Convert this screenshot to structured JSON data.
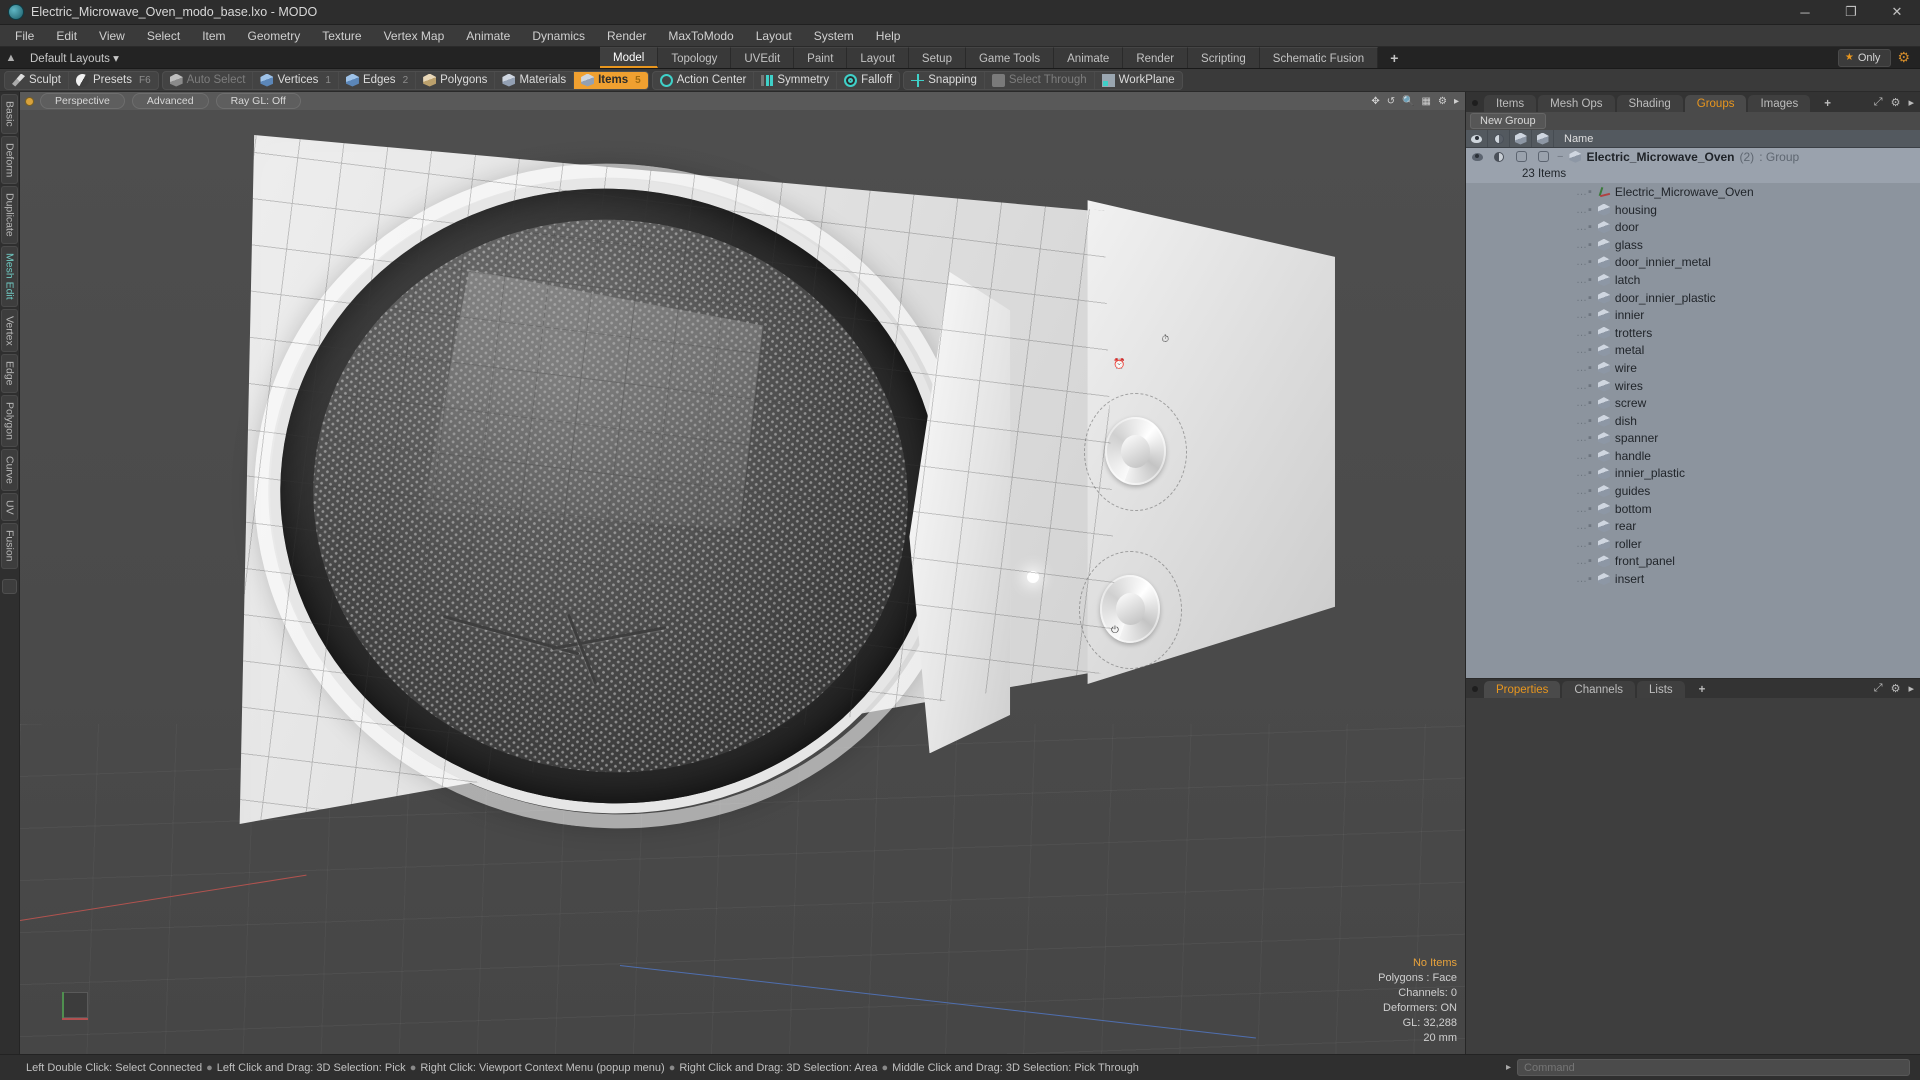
{
  "titlebar": {
    "title": "Electric_Microwave_Oven_modo_base.lxo - MODO",
    "minimize": "─",
    "maximize": "❐",
    "close": "✕"
  },
  "menubar": {
    "items": [
      "File",
      "Edit",
      "View",
      "Select",
      "Item",
      "Geometry",
      "Texture",
      "Vertex Map",
      "Animate",
      "Dynamics",
      "Render",
      "MaxToModo",
      "Layout",
      "System",
      "Help"
    ]
  },
  "layoutbar": {
    "layouts_label": "Default Layouts ▾",
    "tabs": [
      {
        "label": "Model",
        "active": true
      },
      {
        "label": "Topology",
        "active": false
      },
      {
        "label": "UVEdit",
        "active": false
      },
      {
        "label": "Paint",
        "active": false
      },
      {
        "label": "Layout",
        "active": false
      },
      {
        "label": "Setup",
        "active": false
      },
      {
        "label": "Game Tools",
        "active": false
      },
      {
        "label": "Animate",
        "active": false
      },
      {
        "label": "Render",
        "active": false
      },
      {
        "label": "Scripting",
        "active": false
      },
      {
        "label": "Schematic Fusion",
        "active": false
      }
    ],
    "add_tab": "+",
    "only_label": "Only",
    "star_glyph": "★",
    "gear_glyph": "⚙"
  },
  "modebar": {
    "groups": [
      {
        "buttons": [
          {
            "label": "Sculpt",
            "icon": "pencil-icon",
            "shortcut": "",
            "state": "normal"
          },
          {
            "label": "Presets",
            "icon": "sphere-icon",
            "shortcut": "F6",
            "state": "normal"
          }
        ]
      },
      {
        "buttons": [
          {
            "label": "Auto Select",
            "icon": "cube-gray-icon",
            "shortcut": "",
            "state": "disabled"
          },
          {
            "label": "Vertices",
            "icon": "cube-blue-icon",
            "shortcut": "1",
            "state": "normal"
          },
          {
            "label": "Edges",
            "icon": "cube-blue-icon",
            "shortcut": "2",
            "state": "normal"
          },
          {
            "label": "Polygons",
            "icon": "cube-orange-icon",
            "shortcut": "",
            "state": "normal"
          },
          {
            "label": "Materials",
            "icon": "cube-icon",
            "shortcut": "",
            "state": "normal"
          },
          {
            "label": "Items",
            "icon": "cube-icon",
            "shortcut": "5",
            "state": "active"
          }
        ]
      },
      {
        "buttons": [
          {
            "label": "Action Center",
            "icon": "crosshair-icon",
            "shortcut": "",
            "state": "normal"
          },
          {
            "label": "Symmetry",
            "icon": "symmetry-bars-icon",
            "shortcut": "",
            "state": "normal"
          },
          {
            "label": "Falloff",
            "icon": "concentric-ring-icon",
            "shortcut": "",
            "state": "normal"
          }
        ]
      },
      {
        "buttons": [
          {
            "label": "Snapping",
            "icon": "snap-cross-icon",
            "shortcut": "",
            "state": "normal"
          },
          {
            "label": "Select Through",
            "icon": "select-through-icon",
            "shortcut": "",
            "state": "disabled"
          },
          {
            "label": "WorkPlane",
            "icon": "workplane-grid-icon",
            "shortcut": "",
            "state": "normal"
          }
        ]
      }
    ]
  },
  "leftrail": {
    "tabs": [
      "Basic",
      "Deform",
      "Duplicate",
      "Mesh Edit",
      "Vertex",
      "Edge",
      "Polygon",
      "Curve",
      "UV",
      "Fusion"
    ],
    "highlight": "Mesh Edit"
  },
  "viewport": {
    "pills": [
      "Perspective",
      "Advanced",
      "Ray GL: Off"
    ],
    "icons": [
      "move-icon",
      "rotate-icon",
      "zoom-icon",
      "grid-icon",
      "gear-icon",
      "chevron-right-icon"
    ],
    "hud": {
      "selection": "No Items",
      "mode": "Polygons : Face",
      "channels": "Channels: 0",
      "deformers": "Deformers: ON",
      "gl": "GL: 32,288",
      "units": "20 mm"
    }
  },
  "rightpanel": {
    "tabs": [
      {
        "label": "Items",
        "active": false
      },
      {
        "label": "Mesh Ops",
        "active": false
      },
      {
        "label": "Shading",
        "active": false
      },
      {
        "label": "Groups",
        "active": true
      },
      {
        "label": "Images",
        "active": false
      },
      {
        "label": "+",
        "active": false
      }
    ],
    "expand_glyph": "⤢",
    "chevron_glyph": "▸",
    "new_group_button": "New Group",
    "tree_header": {
      "col_visible": "eye-icon",
      "col_shade": "half-circle-icon",
      "col_render": "render-cube-icon",
      "col_select": "select-cube-icon",
      "name": "Name"
    },
    "group": {
      "name": "Electric_Microwave_Oven",
      "count": "(2)",
      "type": ": Group",
      "sub_count": "23 Items"
    },
    "items": [
      {
        "name": "Electric_Microwave_Oven",
        "icon": "locator-icon"
      },
      {
        "name": "housing",
        "icon": "mesh-icon"
      },
      {
        "name": "door",
        "icon": "mesh-icon"
      },
      {
        "name": "glass",
        "icon": "mesh-icon"
      },
      {
        "name": "door_innier_metal",
        "icon": "mesh-icon"
      },
      {
        "name": "latch",
        "icon": "mesh-icon"
      },
      {
        "name": "door_innier_plastic",
        "icon": "mesh-icon"
      },
      {
        "name": "innier",
        "icon": "mesh-icon"
      },
      {
        "name": "trotters",
        "icon": "mesh-icon"
      },
      {
        "name": "metal",
        "icon": "mesh-icon"
      },
      {
        "name": "wire",
        "icon": "mesh-icon"
      },
      {
        "name": "wires",
        "icon": "mesh-icon"
      },
      {
        "name": "screw",
        "icon": "mesh-icon"
      },
      {
        "name": "dish",
        "icon": "mesh-icon"
      },
      {
        "name": "spanner",
        "icon": "mesh-icon"
      },
      {
        "name": "handle",
        "icon": "mesh-icon"
      },
      {
        "name": "innier_plastic",
        "icon": "mesh-icon"
      },
      {
        "name": "guides",
        "icon": "mesh-icon"
      },
      {
        "name": "bottom",
        "icon": "mesh-icon"
      },
      {
        "name": "rear",
        "icon": "mesh-icon"
      },
      {
        "name": "roller",
        "icon": "mesh-icon"
      },
      {
        "name": "front_panel",
        "icon": "mesh-icon"
      },
      {
        "name": "insert",
        "icon": "mesh-icon"
      }
    ],
    "props_tabs": [
      {
        "label": "Properties",
        "active": true
      },
      {
        "label": "Channels",
        "active": false
      },
      {
        "label": "Lists",
        "active": false
      },
      {
        "label": "+",
        "active": false
      }
    ]
  },
  "statusbar": {
    "hints": [
      "Left Double Click: Select Connected",
      "Left Click and Drag: 3D Selection: Pick",
      "Right Click: Viewport Context Menu (popup menu)",
      "Right Click and Drag: 3D Selection: Area",
      "Middle Click and Drag: 3D Selection: Pick Through"
    ],
    "separator": "●",
    "command_placeholder": "Command",
    "command_value": ""
  }
}
